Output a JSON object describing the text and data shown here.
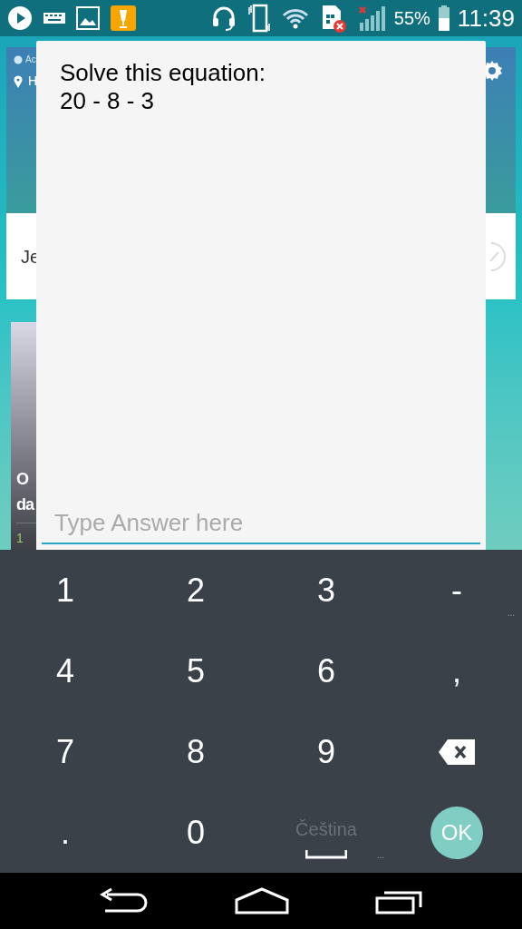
{
  "status_bar": {
    "battery": "55%",
    "time": "11:39"
  },
  "background": {
    "header_card": {
      "line_1": "Ac",
      "line_2": "H"
    },
    "list_card": {
      "text": "Je"
    },
    "photo_card": {
      "title_line_1": "O",
      "title_line_2": "da",
      "footer": "1"
    }
  },
  "dialog": {
    "prompt": [
      "Solve this equation:",
      "20 - 8 - 3"
    ],
    "answer": {
      "placeholder": "Type Answer here"
    }
  },
  "keyboard": {
    "keys": [
      {
        "kind": "char",
        "label": "1"
      },
      {
        "kind": "char",
        "label": "2"
      },
      {
        "kind": "char",
        "label": "3"
      },
      {
        "kind": "char",
        "label": "-",
        "more": "..."
      },
      {
        "kind": "char",
        "label": "4"
      },
      {
        "kind": "char",
        "label": "5"
      },
      {
        "kind": "char",
        "label": "6"
      },
      {
        "kind": "char",
        "label": ","
      },
      {
        "kind": "char",
        "label": "7"
      },
      {
        "kind": "char",
        "label": "8"
      },
      {
        "kind": "char",
        "label": "9"
      },
      {
        "kind": "backspace"
      },
      {
        "kind": "char",
        "label": "."
      },
      {
        "kind": "char",
        "label": "0"
      },
      {
        "kind": "space",
        "label": "Čeština",
        "more": "..."
      },
      {
        "kind": "ok",
        "label": "OK"
      }
    ]
  }
}
